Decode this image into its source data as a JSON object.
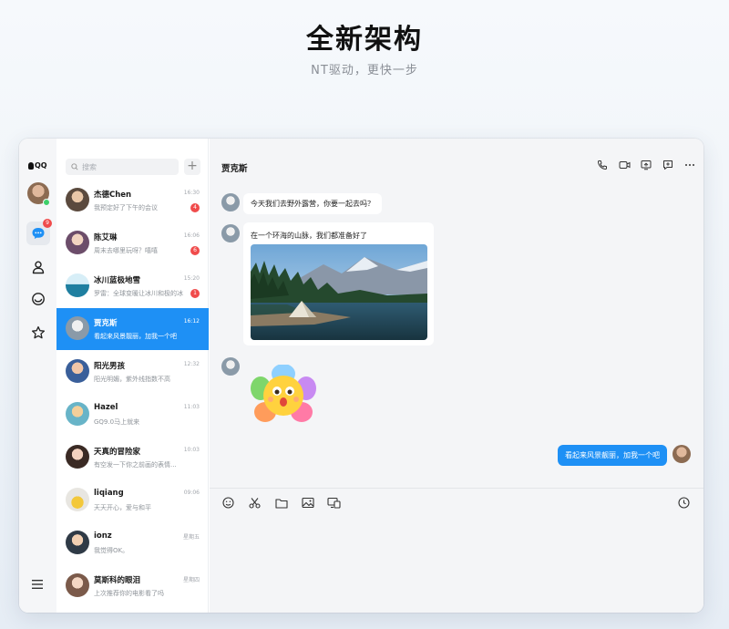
{
  "hero": {
    "title": "全新架构",
    "subtitle": "NT驱动，更快一步"
  },
  "colors": {
    "accent": "#1e90f5",
    "badge": "#f04b4b",
    "online": "#3ecf6a"
  },
  "sidebar": {
    "logo": "QQ",
    "nav": [
      {
        "icon": "message-icon",
        "badge": "9"
      },
      {
        "icon": "contacts-icon"
      },
      {
        "icon": "space-icon"
      },
      {
        "icon": "favorites-star-icon"
      }
    ],
    "menu_icon": "hamburger-menu-icon"
  },
  "search": {
    "placeholder": "搜索",
    "add": "+"
  },
  "conversations": [
    {
      "name": "杰德Chen",
      "time": "16:30",
      "preview": "我预定好了下午的会议",
      "unread": "4"
    },
    {
      "name": "陈艾琳",
      "time": "16:06",
      "preview": "周末去哪里玩呀？嘻嘻",
      "unread": "6"
    },
    {
      "name": "冰川蓝极地雪",
      "time": "15:20",
      "preview": "罗雷：全球变暖让冰川和极的冰",
      "unread": "1"
    },
    {
      "name": "贾克斯",
      "time": "16:12",
      "preview": "看起来风景靓丽，加我一个吧",
      "active": true
    },
    {
      "name": "阳光男孩",
      "time": "12:32",
      "preview": "阳光明媚，紫外线指数不高"
    },
    {
      "name": "Hazel",
      "time": "11:03",
      "preview": "GQ9.0马上就来"
    },
    {
      "name": "天真的冒险家",
      "time": "10:03",
      "preview": "有空发一下你之前画的表情..."
    },
    {
      "name": "liqiang",
      "time": "09:06",
      "preview": "天天开心，爱与和平"
    },
    {
      "name": "ionz",
      "time": "星期五",
      "preview": "我觉得OK。"
    },
    {
      "name": "莫斯科的眼泪",
      "time": "星期四",
      "preview": "上次推荐你的电影看了吗"
    }
  ],
  "chat": {
    "title": "贾克斯",
    "header_icons": [
      "phone-icon",
      "video-icon",
      "screen-share-icon",
      "add-app-icon",
      "more-icon"
    ],
    "messages": [
      {
        "from": "other",
        "text": "今天我们去野外露营，你要一起去吗？"
      },
      {
        "from": "other",
        "text": "在一个环海的山脉，我们都准备好了",
        "image": "camping-lake-photo"
      },
      {
        "from": "other",
        "sticker": "flower-sticker"
      },
      {
        "from": "me",
        "text": "看起来风景靓丽，加我一个吧"
      }
    ],
    "toolbar_icons": [
      "emoji-icon",
      "scissors-icon",
      "folder-icon",
      "image-icon",
      "screen-icon"
    ],
    "history_icon": "clock-icon"
  }
}
